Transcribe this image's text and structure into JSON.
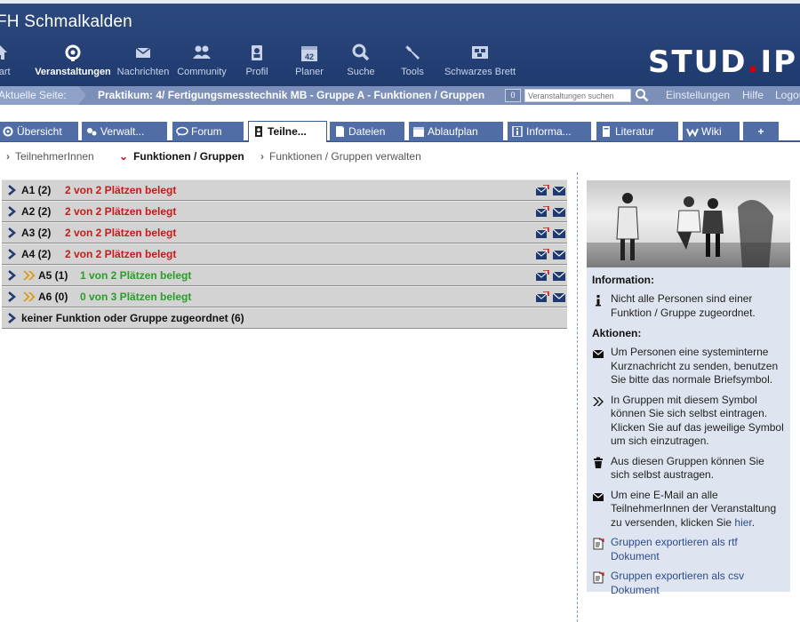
{
  "header": {
    "site_title": "FH Schmalkalden",
    "logo_main": "STUD",
    "logo_dot": ".",
    "logo_end": "IP"
  },
  "nav": [
    {
      "label": "Start",
      "icon": "home-icon"
    },
    {
      "label": "Veranstaltungen",
      "icon": "courses-icon",
      "active": true
    },
    {
      "label": "Nachrichten",
      "icon": "envelope-icon"
    },
    {
      "label": "Community",
      "icon": "community-icon"
    },
    {
      "label": "Profil",
      "icon": "profile-icon"
    },
    {
      "label": "Planer",
      "icon": "calendar-icon",
      "badge": "42"
    },
    {
      "label": "Suche",
      "icon": "search-icon"
    },
    {
      "label": "Tools",
      "icon": "wrench-icon"
    },
    {
      "label": "Schwarzes Brett",
      "icon": "board-icon"
    }
  ],
  "crumbbar": {
    "label": "Aktuelle Seite:",
    "text": "Praktikum: 4/ Fertigungsmesstechnik MB - Gruppe A - Funktionen / Gruppen",
    "search_count": "0",
    "search_placeholder": "Veranstaltungen suchen",
    "settings": "Einstellungen",
    "help": "Hilfe",
    "logout": "Logout"
  },
  "tabs": [
    {
      "label": "Übersicht",
      "icon": "overview-icon"
    },
    {
      "label": "Verwalt...",
      "icon": "admin-icon"
    },
    {
      "label": "Forum",
      "icon": "forum-icon"
    },
    {
      "label": "Teilne...",
      "icon": "participants-icon",
      "active": true
    },
    {
      "label": "Dateien",
      "icon": "files-icon"
    },
    {
      "label": "Ablaufplan",
      "icon": "schedule-icon"
    },
    {
      "label": "Informa...",
      "icon": "info-icon"
    },
    {
      "label": "Literatur",
      "icon": "literature-icon"
    },
    {
      "label": "Wiki",
      "icon": "wiki-icon"
    },
    {
      "label": "+",
      "icon": ""
    }
  ],
  "subnav": [
    {
      "label": "TeilnehmerInnen"
    },
    {
      "label": "Funktionen / Gruppen",
      "active": true
    },
    {
      "label": "Funktionen / Gruppen verwalten"
    }
  ],
  "groups": [
    {
      "name": "A1 (2)",
      "status": "2 von 2 Plätzen belegt",
      "full": true,
      "self_enroll": false
    },
    {
      "name": "A2 (2)",
      "status": "2 von 2 Plätzen belegt",
      "full": true,
      "self_enroll": false
    },
    {
      "name": "A3 (2)",
      "status": "2 von 2 Plätzen belegt",
      "full": true,
      "self_enroll": false
    },
    {
      "name": "A4 (2)",
      "status": "2 von 2 Plätzen belegt",
      "full": true,
      "self_enroll": false
    },
    {
      "name": "A5 (1)",
      "status": "1 von 2 Plätzen belegt",
      "full": false,
      "self_enroll": true
    },
    {
      "name": "A6 (0)",
      "status": "0 von 3 Plätzen belegt",
      "full": false,
      "self_enroll": true
    },
    {
      "name": "keiner Funktion oder Gruppe zugeordnet (6)",
      "status": "",
      "full": false,
      "self_enroll": false,
      "no_actions": true
    }
  ],
  "sidebar": {
    "info_heading": "Information:",
    "info_text": "Nicht alle Personen sind einer Funktion / Gruppe zugeordnet.",
    "actions_heading": "Aktionen:",
    "action_message": "Um Personen eine systeminterne Kurznachricht zu senden, benutzen Sie bitte das normale Briefsymbol.",
    "action_selfenroll": "In Gruppen mit diesem Symbol können Sie sich selbst eintragen. Klicken Sie auf das jeweilige Symbol um sich einzutragen.",
    "action_selfremove": "Aus diesen Gruppen können Sie sich selbst austragen.",
    "action_email_prefix": "Um eine E-Mail an alle TeilnehmerInnen der Veranstaltung zu versenden, klicken Sie",
    "action_email_link": "hier",
    "action_email_suffix": ".",
    "export_rtf": "Gruppen exportieren als rtf Dokument",
    "export_csv": "Gruppen exportieren als csv Dokument"
  }
}
